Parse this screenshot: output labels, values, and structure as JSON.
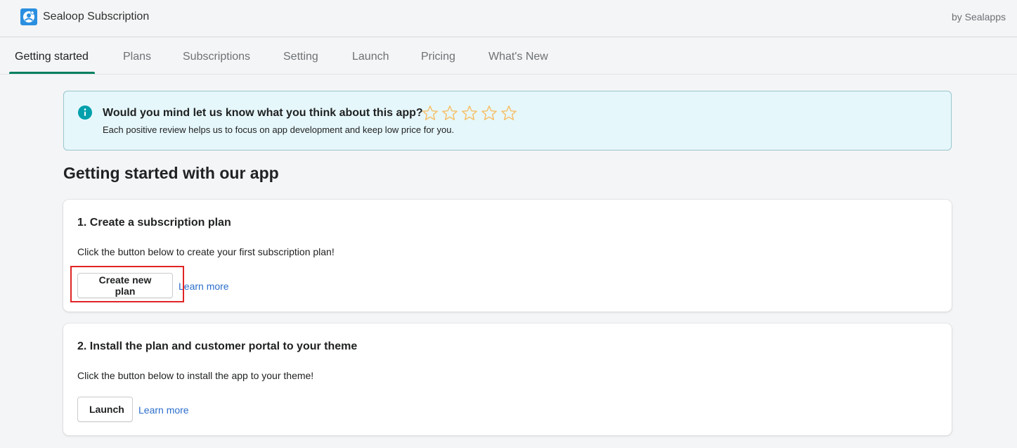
{
  "header": {
    "app_name": "Sealoop Subscription",
    "byline": "by Sealapps"
  },
  "tabs": [
    {
      "label": "Getting started",
      "active": true
    },
    {
      "label": "Plans",
      "active": false
    },
    {
      "label": "Subscriptions",
      "active": false
    },
    {
      "label": "Setting",
      "active": false
    },
    {
      "label": "Launch",
      "active": false
    },
    {
      "label": "Pricing",
      "active": false
    },
    {
      "label": "What's New",
      "active": false
    }
  ],
  "banner": {
    "icon": "info-icon",
    "title": "Would you mind let us know what you think about this app?",
    "subtitle": "Each positive review helps us to focus on app development and keep low price for you.",
    "rating_stars": 5,
    "rating_selected": 0
  },
  "page": {
    "title": "Getting started with our app"
  },
  "steps": [
    {
      "title": "1. Create a subscription plan",
      "text": "Click the button below to create your first subscription plan!",
      "button_label": "Create new plan",
      "link_label": "Learn more"
    },
    {
      "title": "2. Install the plan and customer portal to your theme",
      "text": "Click the button below to install the app to your theme!",
      "button_label": "Launch",
      "link_label": "Learn more"
    }
  ],
  "colors": {
    "accent": "#008060",
    "link": "#2c6ecb",
    "banner_bg": "#e6f7fb",
    "banner_border": "#98c6cd",
    "info_icon": "#00a0ac",
    "star_outline": "#f5c16c",
    "highlight": "#e02424"
  }
}
